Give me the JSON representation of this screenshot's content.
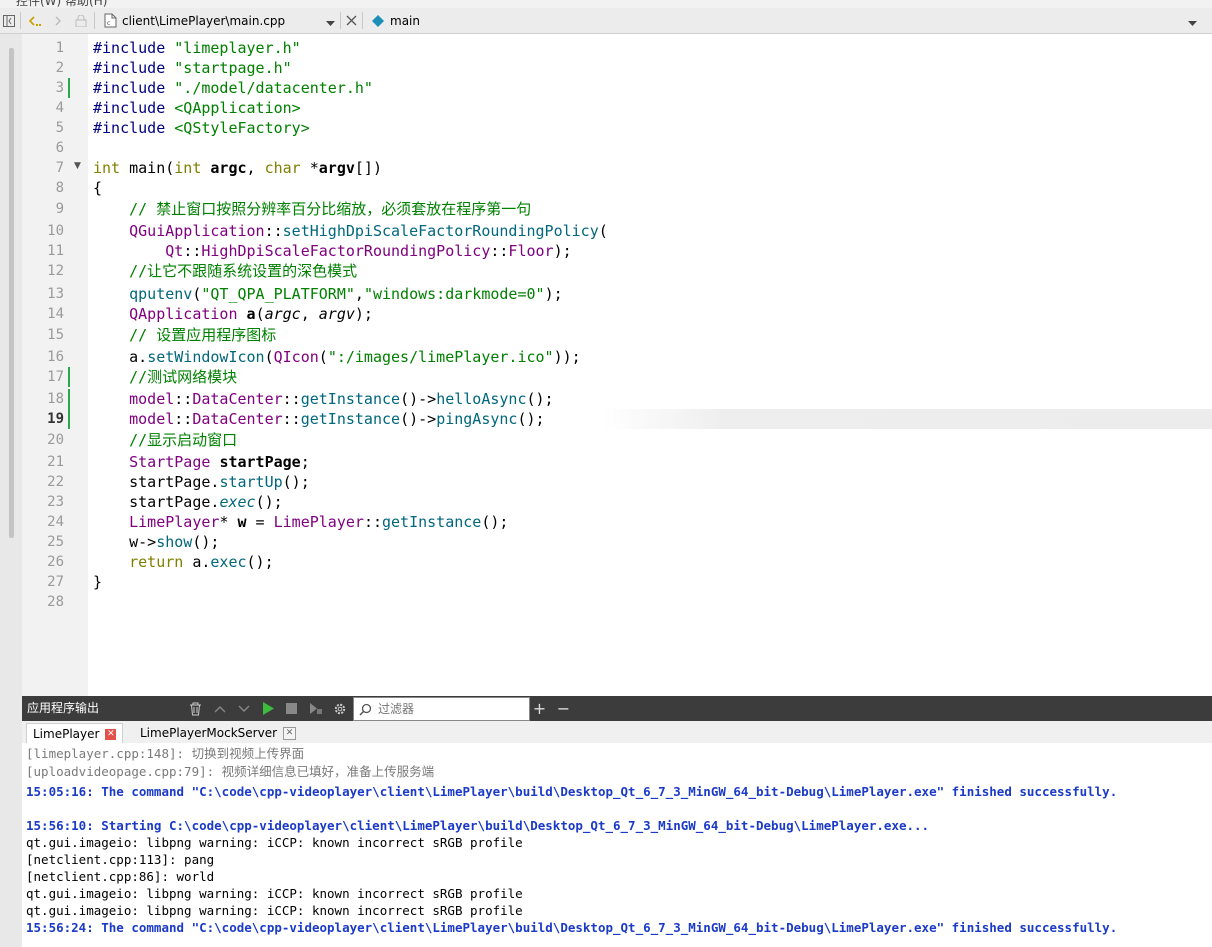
{
  "menubar": {
    "items_partial": "控件(W)  帮助(H)"
  },
  "toolbar": {
    "back_icon": "chevron-left-icon",
    "forward_icon": "chevron-right-icon",
    "file_path": "client\\LimePlayer\\main.cpp",
    "symbol": "main"
  },
  "editor": {
    "current_line": 19,
    "modified_lines": [
      3,
      17,
      18,
      19
    ],
    "fold_lines": [
      7
    ],
    "lines": [
      "1",
      "2",
      "3",
      "4",
      "5",
      "6",
      "7",
      "8",
      "9",
      "10",
      "11",
      "12",
      "13",
      "14",
      "15",
      "16",
      "17",
      "18",
      "19",
      "20",
      "21",
      "22",
      "23",
      "24",
      "25",
      "26",
      "27",
      "28"
    ],
    "code": {
      "l1_pp": "#include",
      "l1_str": " \"limeplayer.h\"",
      "l2_pp": "#include",
      "l2_str": " \"startpage.h\"",
      "l3_pp": "#include",
      "l3_str": " \"./model/datacenter.h\"",
      "l4_pp": "#include",
      "l4_str": " <QApplication>",
      "l5_pp": "#include",
      "l5_str": " <QStyleFactory>",
      "l7_a": "int",
      "l7_b": " main(",
      "l7_c": "int",
      "l7_d": " ",
      "l7_e": "argc",
      "l7_f": ", ",
      "l7_g": "char",
      "l7_h": " *",
      "l7_i": "argv",
      "l7_j": "[])",
      "l8": "{",
      "l9": "    // 禁止窗口按照分辨率百分比缩放，必须套放在程序第一句",
      "l10_a": "QGuiApplication",
      "l10_b": "::",
      "l10_c": "setHighDpiScaleFactorRoundingPolicy",
      "l10_d": "(",
      "l11_a": "Qt",
      "l11_b": "::",
      "l11_c": "HighDpiScaleFactorRoundingPolicy",
      "l11_d": "::",
      "l11_e": "Floor",
      "l11_f": ");",
      "l12": "    //让它不跟随系统设置的深色模式",
      "l13_a": "qputenv",
      "l13_b": "(",
      "l13_c": "\"QT_QPA_PLATFORM\"",
      "l13_d": ",",
      "l13_e": "\"windows:darkmode=0\"",
      "l13_f": ");",
      "l14_a": "QApplication",
      "l14_b": " ",
      "l14_c": "a",
      "l14_d": "(",
      "l14_e": "argc",
      "l14_f": ", ",
      "l14_g": "argv",
      "l14_h": ");",
      "l15": "    // 设置应用程序图标",
      "l16_a": "a",
      "l16_b": ".",
      "l16_c": "setWindowIcon",
      "l16_d": "(",
      "l16_e": "QIcon",
      "l16_f": "(",
      "l16_g": "\":/images/limePlayer.ico\"",
      "l16_h": "));",
      "l17": "    //测试网络模块",
      "l18_a": "model",
      "l18_b": "::",
      "l18_c": "DataCenter",
      "l18_d": "::",
      "l18_e": "getInstance",
      "l18_f": "()->",
      "l18_g": "helloAsync",
      "l18_h": "();",
      "l19_a": "model",
      "l19_b": "::",
      "l19_c": "DataCenter",
      "l19_d": "::",
      "l19_e": "getInstance",
      "l19_f": "()->",
      "l19_g": "pingAsync",
      "l19_h": "();",
      "l20": "    //显示启动窗口",
      "l21_a": "StartPage",
      "l21_b": " ",
      "l21_c": "startPage",
      "l21_d": ";",
      "l22_a": "startPage",
      "l22_b": ".",
      "l22_c": "startUp",
      "l22_d": "();",
      "l23_a": "startPage",
      "l23_b": ".",
      "l23_c": "exec",
      "l23_d": "();",
      "l24_a": "LimePlayer",
      "l24_b": "* ",
      "l24_c": "w",
      "l24_d": " = ",
      "l24_e": "LimePlayer",
      "l24_f": "::",
      "l24_g": "getInstance",
      "l24_h": "();",
      "l25_a": "w",
      "l25_b": "->",
      "l25_c": "show",
      "l25_d": "();",
      "l26_a": "return",
      "l26_b": " ",
      "l26_c": "a",
      "l26_d": ".",
      "l26_e": "exec",
      "l26_f": "();",
      "l27": "}"
    }
  },
  "output_panel": {
    "title": "应用程序输出",
    "filter_placeholder": "过滤器",
    "tabs": [
      {
        "label": "LimePlayer",
        "active": true
      },
      {
        "label": "LimePlayerMockServer",
        "active": false
      }
    ],
    "lines": [
      "[limeplayer.cpp:148]: 切换到视频上传界面",
      "[uploadvideopage.cpp:79]: 视频详细信息已填好，准备上传服务端",
      "15:05:16: The command \"C:\\code\\cpp-videoplayer\\client\\LimePlayer\\build\\Desktop_Qt_6_7_3_MinGW_64_bit-Debug\\LimePlayer.exe\" finished successfully.",
      "",
      "15:56:10: Starting C:\\code\\cpp-videoplayer\\client\\LimePlayer\\build\\Desktop_Qt_6_7_3_MinGW_64_bit-Debug\\LimePlayer.exe...",
      "qt.gui.imageio: libpng warning: iCCP: known incorrect sRGB profile",
      "[netclient.cpp:113]: pang",
      "[netclient.cpp:86]: world",
      "qt.gui.imageio: libpng warning: iCCP: known incorrect sRGB profile",
      "qt.gui.imageio: libpng warning: iCCP: known incorrect sRGB profile",
      "15:56:24: The command \"C:\\code\\cpp-videoplayer\\client\\LimePlayer\\build\\Desktop_Qt_6_7_3_MinGW_64_bit-Debug\\LimePlayer.exe\" finished successfully."
    ],
    "line_styles": [
      "grey",
      "grey",
      "blue",
      "norm",
      "blue",
      "norm",
      "norm",
      "norm",
      "norm",
      "norm",
      "blue"
    ]
  },
  "colors": {
    "preprocessor": "#000080",
    "string": "#008000",
    "keyword": "#808000",
    "type": "#800080",
    "function": "#00677c",
    "output_blue": "#1a3ac7",
    "modified_marker": "#2da44e"
  }
}
